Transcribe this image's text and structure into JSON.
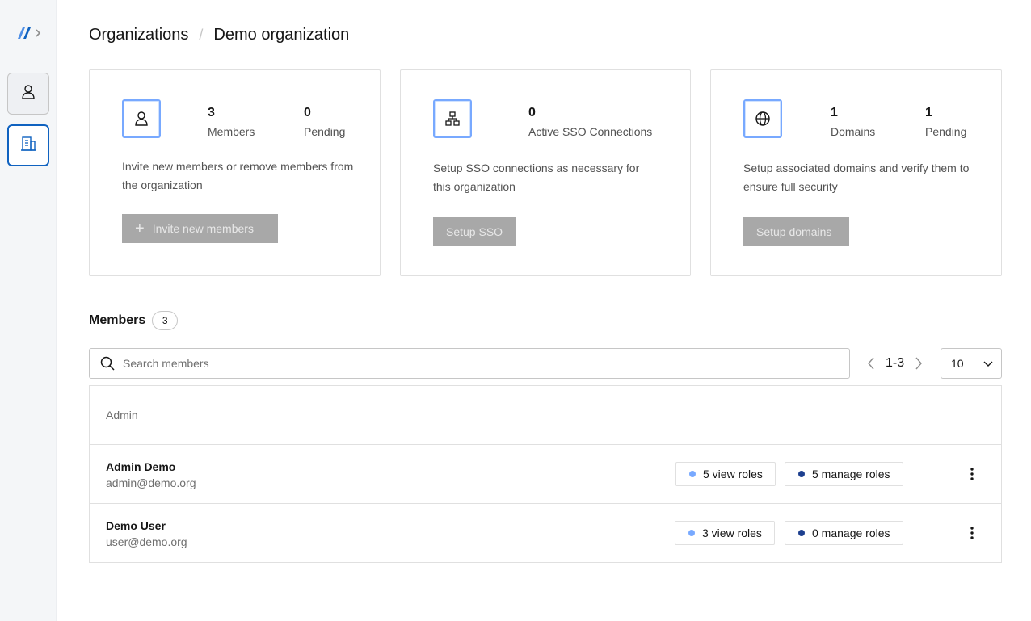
{
  "app": {
    "accent": "#0f62c0"
  },
  "sidebar": {
    "logo": "logo-icon",
    "items": [
      {
        "icon": "user-icon",
        "active": false
      },
      {
        "icon": "organization-building-icon",
        "active": true
      }
    ]
  },
  "breadcrumb": {
    "items": [
      "Organizations",
      "Demo organization"
    ],
    "separator": "/"
  },
  "cards": {
    "members": {
      "icon": "user-icon",
      "stats": [
        {
          "value": "3",
          "label": "Members"
        },
        {
          "value": "0",
          "label": "Pending"
        }
      ],
      "description": "Invite new members or remove members from the organization",
      "button_label": "Invite new members"
    },
    "sso": {
      "icon": "hierarchy-icon",
      "stats": [
        {
          "value": "0",
          "label": "Active SSO Connections"
        }
      ],
      "description": "Setup SSO connections as necessary for this organization",
      "button_label": "Setup SSO"
    },
    "domains": {
      "icon": "globe-icon",
      "stats": [
        {
          "value": "1",
          "label": "Domains"
        },
        {
          "value": "1",
          "label": "Pending"
        }
      ],
      "description": "Setup associated domains and verify them to ensure full security",
      "button_label": "Setup domains"
    }
  },
  "members_section": {
    "title": "Members",
    "count": "3",
    "search_placeholder": "Search members",
    "pagination_range": "1-3",
    "page_size": "10",
    "table_group_header": "Admin",
    "rows": [
      {
        "name": "Admin Demo",
        "email": "admin@demo.org",
        "view_roles": "5 view roles",
        "manage_roles": "5 manage roles"
      },
      {
        "name": "Demo User",
        "email": "user@demo.org",
        "view_roles": "3 view roles",
        "manage_roles": "0 manage roles"
      }
    ]
  },
  "colors": {
    "view_role_dot": "#78a9ff",
    "manage_role_dot": "#1d3f8f",
    "disabled_button": "#a8a8a8",
    "icon_border": "#78a9ff"
  }
}
